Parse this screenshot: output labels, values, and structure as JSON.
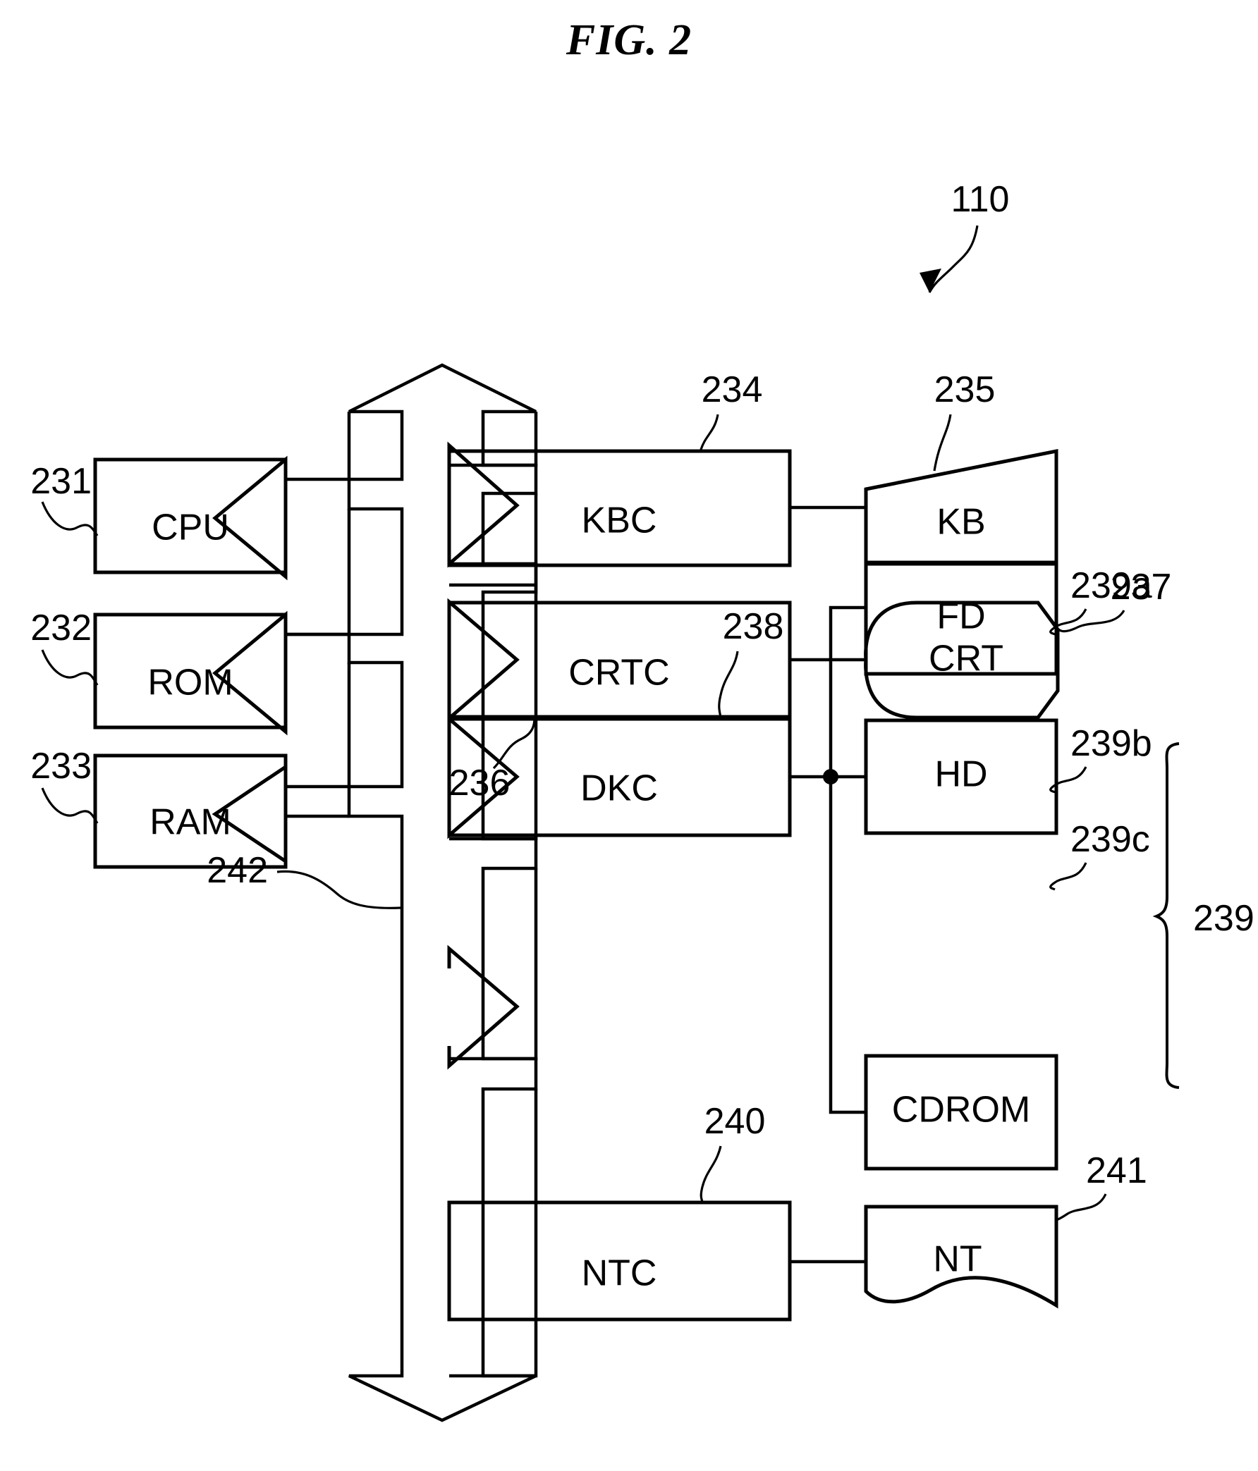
{
  "figure": {
    "title": "FIG. 2",
    "system_ref": "110"
  },
  "blocks": [
    {
      "id": "cpu",
      "label": "CPU",
      "ref": "231"
    },
    {
      "id": "rom",
      "label": "ROM",
      "ref": "232"
    },
    {
      "id": "ram",
      "label": "RAM",
      "ref": "233"
    },
    {
      "id": "kbc",
      "label": "KBC",
      "ref": "234"
    },
    {
      "id": "kb",
      "label": "KB",
      "ref": "235"
    },
    {
      "id": "crtc",
      "label": "CRTC",
      "ref": "236"
    },
    {
      "id": "crt",
      "label": "CRT",
      "ref": "237"
    },
    {
      "id": "dkc",
      "label": "DKC",
      "ref": "238"
    },
    {
      "id": "fd",
      "label": "FD",
      "ref": "239a"
    },
    {
      "id": "hd",
      "label": "HD",
      "ref": "239b"
    },
    {
      "id": "cdrom",
      "label": "CDROM",
      "ref": "239c"
    },
    {
      "id": "ntc",
      "label": "NTC",
      "ref": "240"
    },
    {
      "id": "nt",
      "label": "NT",
      "ref": "241"
    }
  ],
  "groups": [
    {
      "id": "disk-group",
      "ref": "239",
      "members": [
        "fd",
        "hd",
        "cdrom"
      ]
    }
  ],
  "bus": {
    "ref": "242",
    "description": "system bus"
  },
  "colors": {
    "line": "#000000",
    "background": "#ffffff"
  }
}
